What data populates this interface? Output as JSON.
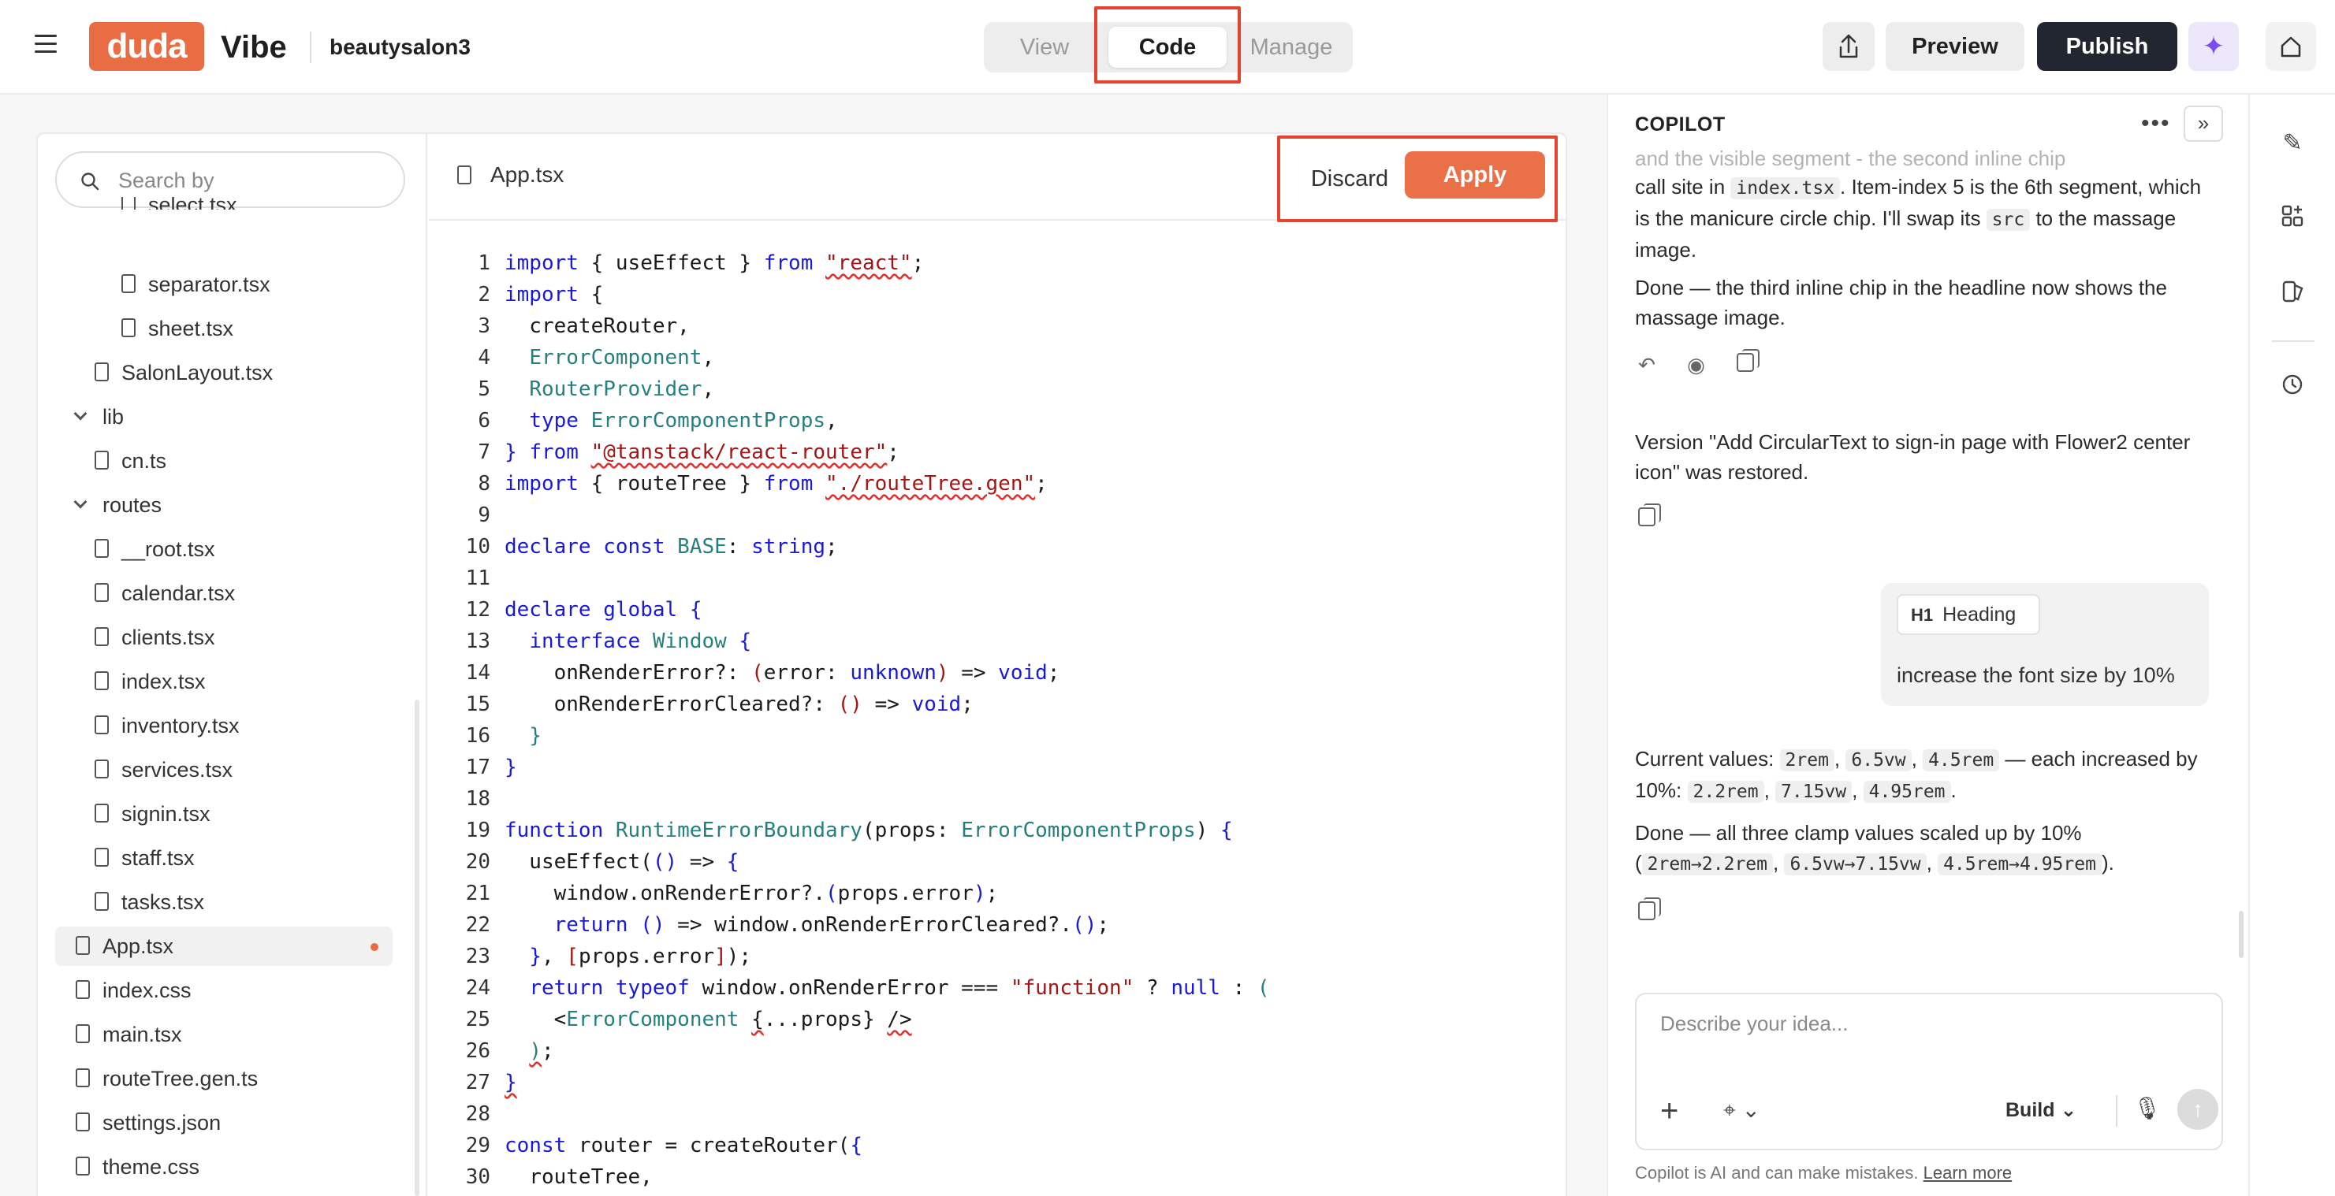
{
  "header": {
    "brand_logo": "duda",
    "brand_product": "Vibe",
    "site_name": "beautysalon3",
    "tabs": [
      {
        "label": "View",
        "state": "inactive"
      },
      {
        "label": "Code",
        "state": "active"
      },
      {
        "label": "Manage",
        "state": "disabled"
      }
    ],
    "preview_label": "Preview",
    "publish_label": "Publish",
    "icons": [
      "hamburger-icon",
      "share-icon",
      "sparkle-icon",
      "home-icon"
    ]
  },
  "file_tree": {
    "search_placeholder": "Search by",
    "items": [
      {
        "label": "select.tsx",
        "type": "file",
        "indent": 3,
        "partial": true
      },
      {
        "label": "separator.tsx",
        "type": "file",
        "indent": 3
      },
      {
        "label": "sheet.tsx",
        "type": "file",
        "indent": 3
      },
      {
        "label": "SalonLayout.tsx",
        "type": "file",
        "indent": 2
      },
      {
        "label": "lib",
        "type": "folder",
        "indent": 1
      },
      {
        "label": "cn.ts",
        "type": "file",
        "indent": 2
      },
      {
        "label": "routes",
        "type": "folder",
        "indent": 1
      },
      {
        "label": "__root.tsx",
        "type": "file",
        "indent": 2
      },
      {
        "label": "calendar.tsx",
        "type": "file",
        "indent": 2
      },
      {
        "label": "clients.tsx",
        "type": "file",
        "indent": 2
      },
      {
        "label": "index.tsx",
        "type": "file",
        "indent": 2
      },
      {
        "label": "inventory.tsx",
        "type": "file",
        "indent": 2
      },
      {
        "label": "services.tsx",
        "type": "file",
        "indent": 2
      },
      {
        "label": "signin.tsx",
        "type": "file",
        "indent": 2
      },
      {
        "label": "staff.tsx",
        "type": "file",
        "indent": 2
      },
      {
        "label": "tasks.tsx",
        "type": "file",
        "indent": 2
      },
      {
        "label": "App.tsx",
        "type": "file",
        "indent": 1,
        "active": true,
        "modified": true
      },
      {
        "label": "index.css",
        "type": "file",
        "indent": 1
      },
      {
        "label": "main.tsx",
        "type": "file",
        "indent": 1
      },
      {
        "label": "routeTree.gen.ts",
        "type": "file",
        "indent": 1
      },
      {
        "label": "settings.json",
        "type": "file",
        "indent": 1
      },
      {
        "label": "theme.css",
        "type": "file",
        "indent": 1
      }
    ]
  },
  "code_editor": {
    "file_name": "App.tsx",
    "discard_label": "Discard",
    "apply_label": "Apply",
    "lines": [
      [
        [
          "kw",
          "import"
        ],
        [
          "t",
          " { useEffect } "
        ],
        [
          "kw",
          "from"
        ],
        [
          "t",
          " "
        ],
        [
          "strsq",
          "\"react\""
        ],
        [
          "t",
          ";"
        ]
      ],
      [
        [
          "kw",
          "import"
        ],
        [
          "t",
          " {"
        ]
      ],
      [
        [
          "t",
          "  createRouter,"
        ]
      ],
      [
        [
          "t",
          "  "
        ],
        [
          "ty",
          "ErrorComponent"
        ],
        [
          "t",
          ","
        ]
      ],
      [
        [
          "t",
          "  "
        ],
        [
          "ty",
          "RouterProvider"
        ],
        [
          "t",
          ","
        ]
      ],
      [
        [
          "t",
          "  "
        ],
        [
          "kw",
          "type"
        ],
        [
          "t",
          " "
        ],
        [
          "ty",
          "ErrorComponentProps"
        ],
        [
          "t",
          ","
        ]
      ],
      [
        [
          "kw",
          "}"
        ],
        [
          "t",
          " "
        ],
        [
          "kw",
          "from"
        ],
        [
          "t",
          " "
        ],
        [
          "strsq",
          "\"@tanstack/react-router\""
        ],
        [
          "t",
          ";"
        ]
      ],
      [
        [
          "kw",
          "import"
        ],
        [
          "t",
          " { routeTree } "
        ],
        [
          "kw",
          "from"
        ],
        [
          "t",
          " "
        ],
        [
          "strsq",
          "\"./routeTree.gen\""
        ],
        [
          "t",
          ";"
        ]
      ],
      [],
      [
        [
          "kw",
          "declare"
        ],
        [
          "t",
          " "
        ],
        [
          "kw",
          "const"
        ],
        [
          "t",
          " "
        ],
        [
          "ty",
          "BASE"
        ],
        [
          "t",
          ": "
        ],
        [
          "kw",
          "string"
        ],
        [
          "t",
          ";"
        ]
      ],
      [],
      [
        [
          "kw",
          "declare"
        ],
        [
          "t",
          " "
        ],
        [
          "kw",
          "global"
        ],
        [
          "t",
          " "
        ],
        [
          "kw",
          "{"
        ]
      ],
      [
        [
          "t",
          "  "
        ],
        [
          "kw",
          "interface"
        ],
        [
          "t",
          " "
        ],
        [
          "ty",
          "Window"
        ],
        [
          "t",
          " "
        ],
        [
          "kw",
          "{"
        ]
      ],
      [
        [
          "t",
          "    onRenderError?: "
        ],
        [
          "str",
          "("
        ],
        [
          "t",
          "error: "
        ],
        [
          "kw",
          "unknown"
        ],
        [
          "str",
          ")"
        ],
        [
          "t",
          " => "
        ],
        [
          "kw",
          "void"
        ],
        [
          "t",
          ";"
        ]
      ],
      [
        [
          "t",
          "    onRenderErrorCleared?: "
        ],
        [
          "str",
          "()"
        ],
        [
          "t",
          " => "
        ],
        [
          "kw",
          "void"
        ],
        [
          "t",
          ";"
        ]
      ],
      [
        [
          "t",
          "  "
        ],
        [
          "ty",
          "}"
        ]
      ],
      [
        [
          "kw",
          "}"
        ]
      ],
      [],
      [
        [
          "kw",
          "function"
        ],
        [
          "t",
          " "
        ],
        [
          "ty",
          "RuntimeErrorBoundary"
        ],
        [
          "t",
          "(props: "
        ],
        [
          "ty",
          "ErrorComponentProps"
        ],
        [
          "t",
          ") "
        ],
        [
          "kw",
          "{"
        ]
      ],
      [
        [
          "t",
          "  useEffect("
        ],
        [
          "kw",
          "()"
        ],
        [
          "t",
          " => "
        ],
        [
          "kw",
          "{"
        ]
      ],
      [
        [
          "t",
          "    window.onRenderError?."
        ],
        [
          "kw",
          "("
        ],
        [
          "t",
          "props.error"
        ],
        [
          "kw",
          ")"
        ],
        [
          "t",
          ";"
        ]
      ],
      [
        [
          "t",
          "    "
        ],
        [
          "kw",
          "return"
        ],
        [
          "t",
          " "
        ],
        [
          "kw",
          "()"
        ],
        [
          "t",
          " => window.onRenderErrorCleared?."
        ],
        [
          "kw",
          "()"
        ],
        [
          "t",
          ";"
        ]
      ],
      [
        [
          "t",
          "  "
        ],
        [
          "kw",
          "}"
        ],
        [
          "t",
          ", "
        ],
        [
          "str",
          "["
        ],
        [
          "t",
          "props.error"
        ],
        [
          "str",
          "]"
        ],
        [
          "t",
          ");"
        ]
      ],
      [
        [
          "t",
          "  "
        ],
        [
          "kw",
          "return"
        ],
        [
          "t",
          " "
        ],
        [
          "kw",
          "typeof"
        ],
        [
          "t",
          " window.onRenderError === "
        ],
        [
          "str",
          "\"function\""
        ],
        [
          "t",
          " ? "
        ],
        [
          "kw",
          "null"
        ],
        [
          "t",
          " : "
        ],
        [
          "ty",
          "("
        ]
      ],
      [
        [
          "t",
          "    <"
        ],
        [
          "ty",
          "ErrorComponent"
        ],
        [
          "t",
          " "
        ],
        [
          "sq",
          "{"
        ],
        [
          "t",
          "...props} "
        ],
        [
          "sq",
          "/>"
        ]
      ],
      [
        [
          "t",
          "  "
        ],
        [
          "sqty",
          ")"
        ],
        [
          "t",
          ";"
        ]
      ],
      [
        [
          "sqkw",
          "}"
        ]
      ],
      [],
      [
        [
          "kw",
          "const"
        ],
        [
          "t",
          " router = createRouter("
        ],
        [
          "kw",
          "{"
        ]
      ],
      [
        [
          "t",
          "  routeTree,"
        ]
      ]
    ]
  },
  "copilot": {
    "title": "COPILOT",
    "faded_top": "and the visible segment - the second inline chip",
    "msg1_a": "call site in ",
    "msg1_code1": "index.tsx",
    "msg1_b": ". Item-index 5 is the 6th segment, which is the manicure circle chip. I'll swap its ",
    "msg1_code2": "src",
    "msg1_c": " to the massage image.",
    "msg2": "Done — the third inline chip in the headline now shows the massage image.",
    "msg3": "Version \"Add CircularText to sign-in page with Flower2 center icon\" was restored.",
    "user_chip_icon": "H1",
    "user_chip_label": "Heading",
    "user_message": "increase the font size by 10%",
    "msg4_a": "Current values: ",
    "msg4_v1": "2rem",
    "msg4_v2": "6.5vw",
    "msg4_v3": "4.5rem",
    "msg4_b": " — each increased by 10%: ",
    "msg4_v4": "2.2rem",
    "msg4_v5": "7.15vw",
    "msg4_v6": "4.95rem",
    "msg4_c": ".",
    "msg5_a": "Done — all three clamp values scaled up by 10% (",
    "msg5_v1": "2rem→2.2rem",
    "msg5_v2": "6.5vw→7.15vw",
    "msg5_v3": "4.5rem→4.95rem",
    "msg5_b": ").",
    "composer_placeholder": "Describe your idea...",
    "mode_label": "Build",
    "disclaimer": "Copilot is AI and can make mistakes.",
    "learn_more": "Learn more"
  },
  "colors": {
    "brand_orange": "#ea6c43",
    "publish_dark": "#222630",
    "highlight_red": "#e4442f",
    "keyword_blue": "#1a1ad6",
    "string_red": "#a31515",
    "type_teal": "#267f7f"
  }
}
